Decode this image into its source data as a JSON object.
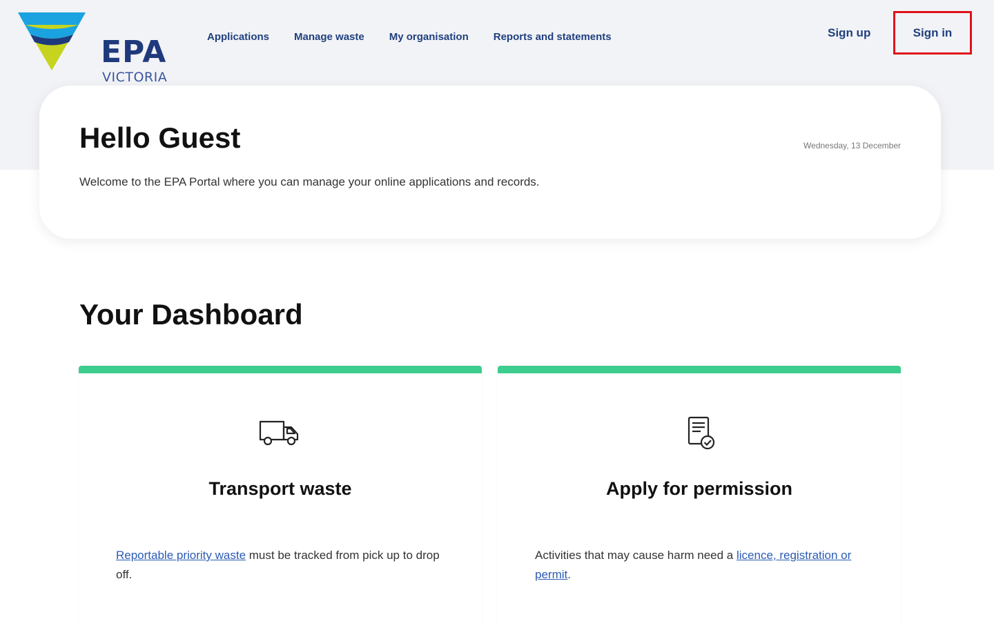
{
  "logo": {
    "wordmark": "EPA",
    "subtext": "VICTORIA"
  },
  "nav": {
    "items": [
      {
        "label": "Applications"
      },
      {
        "label": "Manage waste"
      },
      {
        "label": "My organisation"
      },
      {
        "label": "Reports and statements"
      }
    ],
    "sign_up": "Sign up",
    "sign_in": "Sign in"
  },
  "welcome": {
    "greeting": "Hello Guest",
    "date": "Wednesday, 13 December",
    "intro": "Welcome to the EPA Portal where you can manage your online applications and records."
  },
  "dashboard": {
    "title": "Your Dashboard",
    "cards": [
      {
        "title": "Transport waste",
        "icon": "truck-icon",
        "link_text": "Reportable priority waste",
        "text_after": " must be tracked from pick up to drop off."
      },
      {
        "title": "Apply for permission",
        "icon": "document-check-icon",
        "text_before": "Activities that may cause harm need a ",
        "link_text": "licence, registration or permit",
        "text_after": "."
      }
    ]
  },
  "colors": {
    "brand_navy": "#1f3a7c",
    "accent_green": "#3dcd8f",
    "highlight_red": "#e0121b",
    "logo_blue": "#1aa3e0",
    "logo_lime": "#c6d420"
  }
}
